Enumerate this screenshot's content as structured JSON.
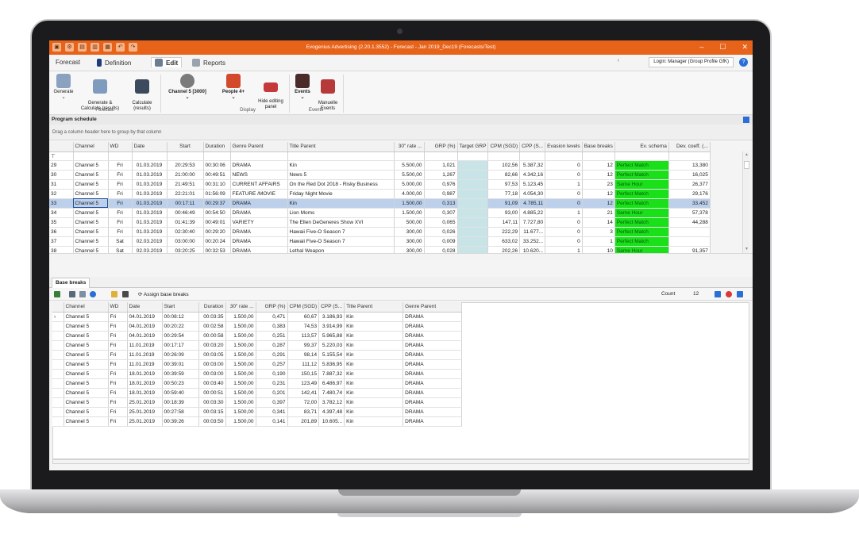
{
  "window": {
    "title": "Evogenius Advertising (2.20.1.3552) - Forecast - Jan 2019_Dec19 (Forecasts/Test)"
  },
  "menu": {
    "tabs": [
      {
        "label": "Forecast"
      },
      {
        "label": "Definition"
      },
      {
        "label": "Edit"
      },
      {
        "label": "Reports"
      }
    ],
    "login_label": "Login: Manager (Group Profile GfK)"
  },
  "ribbon": {
    "generate": "Generate",
    "generate_calc": "Generate &\nCalculate (results)",
    "calculate": "Calculate\n(results)",
    "channel": "Channel 5 [3000]",
    "people": "People 4+",
    "hide_panel": "Hide editing\npanel",
    "events": "Events",
    "manual_events": "Manuelle\nEvents",
    "group_forecast": "Forecast",
    "group_display": "Display",
    "group_events": "Events"
  },
  "schedule": {
    "title": "Program schedule",
    "group_hint": "Drag a column header here to group by that column",
    "columns": [
      "",
      "Channel",
      "WD",
      "Date",
      "Start",
      "Duration",
      "Genre Parent",
      "Title Parent",
      "30\" rate ...",
      "GRP (%)",
      "Target GRP",
      "CPM (SGD)",
      "CPP (S...",
      "Evasion levels",
      "Base breaks",
      "Ev. schema",
      "Dev. coeff. (..."
    ],
    "rows": [
      [
        "29",
        "Channel 5",
        "Fri",
        "01.03.2019",
        "20:29:53",
        "00:30:06",
        "DRAMA",
        "Kin",
        "5.500,00",
        "1,021",
        "",
        "102,56",
        "5.387,32",
        "0",
        "12",
        "Perfect Match",
        "13,380"
      ],
      [
        "30",
        "Channel 5",
        "Fri",
        "01.03.2019",
        "21:00:00",
        "00:49:51",
        "NEWS",
        "News 5",
        "5.500,00",
        "1,267",
        "",
        "82,66",
        "4.342,16",
        "0",
        "12",
        "Perfect Match",
        "16,025"
      ],
      [
        "31",
        "Channel 5",
        "Fri",
        "01.03.2019",
        "21:49:51",
        "00:31:10",
        "CURRENT AFFAIRS",
        "On the Red Dot 2018 - Risky Business",
        "5.000,00",
        "0,976",
        "",
        "97,53",
        "5.123,45",
        "1",
        "23",
        "Same Hour",
        "26,377"
      ],
      [
        "32",
        "Channel 5",
        "Fri",
        "01.03.2019",
        "22:21:01",
        "01:56:09",
        "FEATURE /MOVIE",
        "Friday Night Movie",
        "4.000,00",
        "0,987",
        "",
        "77,18",
        "4.054,30",
        "0",
        "12",
        "Perfect Match",
        "29,176"
      ],
      [
        "33",
        "Channel 5",
        "Fri",
        "01.03.2019",
        "00:17:11",
        "00:29:37",
        "DRAMA",
        "Kin",
        "1.500,00",
        "0,313",
        "",
        "91,09",
        "4.785,11",
        "0",
        "12",
        "Perfect Match",
        "33,452"
      ],
      [
        "34",
        "Channel 5",
        "Fri",
        "01.03.2019",
        "00:46:49",
        "00:54:50",
        "DRAMA",
        "Lion Moms",
        "1.500,00",
        "0,307",
        "",
        "93,00",
        "4.885,22",
        "1",
        "21",
        "Same Hour",
        "57,378"
      ],
      [
        "35",
        "Channel 5",
        "Fri",
        "01.03.2019",
        "01:41:39",
        "00:49:01",
        "VARIETY",
        "The Ellen DeGeneres Show XVI",
        "500,00",
        "0,065",
        "",
        "147,11",
        "7.727,80",
        "0",
        "14",
        "Perfect Match",
        "44,288"
      ],
      [
        "36",
        "Channel 5",
        "Fri",
        "01.03.2019",
        "02:30:40",
        "00:29:20",
        "DRAMA",
        "Hawaii Five-O Season 7",
        "300,00",
        "0,026",
        "",
        "222,29",
        "11.677...",
        "0",
        "3",
        "Perfect Match",
        ""
      ],
      [
        "37",
        "Channel 5",
        "Sat",
        "02.03.2019",
        "03:00:00",
        "00:20:24",
        "DRAMA",
        "Hawaii Five-O Season 7",
        "300,00",
        "0,009",
        "",
        "633,02",
        "33.252...",
        "0",
        "1",
        "Perfect Match",
        ""
      ],
      [
        "38",
        "Channel 5",
        "Sat",
        "02.03.2019",
        "03:20:25",
        "00:32:53",
        "DRAMA",
        "Lethal Weapon",
        "300,00",
        "0,028",
        "",
        "202,26",
        "10.620...",
        "1",
        "10",
        "Same Hour",
        "91,357"
      ]
    ],
    "selected_row": 4
  },
  "base_breaks": {
    "tab_label": "Base breaks",
    "assign_label": "Assign base breaks",
    "count_label": "Count",
    "count_value": "12",
    "columns": [
      "",
      "Channel",
      "WD",
      "Date",
      "Start",
      "Duration",
      "30\" rate ...",
      "GRP (%)",
      "CPM (SGD)",
      "CPP (S...",
      "Title Parent",
      "Genre Parent"
    ],
    "rows": [
      [
        "›",
        "Channel 5",
        "Fri",
        "04.01.2019",
        "00:08:12",
        "00:03:35",
        "1.500,00",
        "0,471",
        "60,67",
        "3.186,93",
        "Kin",
        "DRAMA"
      ],
      [
        "",
        "Channel 5",
        "Fri",
        "04.01.2019",
        "00:20:22",
        "00:02:58",
        "1.500,00",
        "0,383",
        "74,53",
        "3.914,99",
        "Kin",
        "DRAMA"
      ],
      [
        "",
        "Channel 5",
        "Fri",
        "04.01.2019",
        "00:29:54",
        "00:00:58",
        "1.500,00",
        "0,251",
        "113,57",
        "5.965,88",
        "Kin",
        "DRAMA"
      ],
      [
        "",
        "Channel 5",
        "Fri",
        "11.01.2019",
        "00:17:17",
        "00:03:20",
        "1.500,00",
        "0,287",
        "99,37",
        "5.220,03",
        "Kin",
        "DRAMA"
      ],
      [
        "",
        "Channel 5",
        "Fri",
        "11.01.2019",
        "00:26:09",
        "00:03:05",
        "1.500,00",
        "0,291",
        "98,14",
        "5.155,54",
        "Kin",
        "DRAMA"
      ],
      [
        "",
        "Channel 5",
        "Fri",
        "11.01.2019",
        "00:39:01",
        "00:03:00",
        "1.500,00",
        "0,257",
        "111,12",
        "5.836,95",
        "Kin",
        "DRAMA"
      ],
      [
        "",
        "Channel 5",
        "Fri",
        "18.01.2019",
        "00:39:59",
        "00:03:00",
        "1.500,00",
        "0,190",
        "150,15",
        "7.887,32",
        "Kin",
        "DRAMA"
      ],
      [
        "",
        "Channel 5",
        "Fri",
        "18.01.2019",
        "00:50:23",
        "00:03:40",
        "1.500,00",
        "0,231",
        "123,49",
        "6.486,97",
        "Kin",
        "DRAMA"
      ],
      [
        "",
        "Channel 5",
        "Fri",
        "18.01.2019",
        "00:59:40",
        "00:00:51",
        "1.500,00",
        "0,201",
        "142,41",
        "7.480,74",
        "Kin",
        "DRAMA"
      ],
      [
        "",
        "Channel 5",
        "Fri",
        "25.01.2019",
        "00:18:39",
        "00:03:30",
        "1.500,00",
        "0,397",
        "72,00",
        "3.782,12",
        "Kin",
        "DRAMA"
      ],
      [
        "",
        "Channel 5",
        "Fri",
        "25.01.2019",
        "00:27:58",
        "00:03:15",
        "1.500,00",
        "0,341",
        "83,71",
        "4.397,48",
        "Kin",
        "DRAMA"
      ],
      [
        "",
        "Channel 5",
        "Fri",
        "25.01.2019",
        "00:39:26",
        "00:03:50",
        "1.500,00",
        "0,141",
        "201,89",
        "10.605...",
        "Kin",
        "DRAMA"
      ]
    ]
  },
  "colors": {
    "titlebar": "#e8631a",
    "perfect_match": "#1ae01a",
    "selection": "#bcd0eb",
    "target_grp": "#c9e4e7"
  }
}
